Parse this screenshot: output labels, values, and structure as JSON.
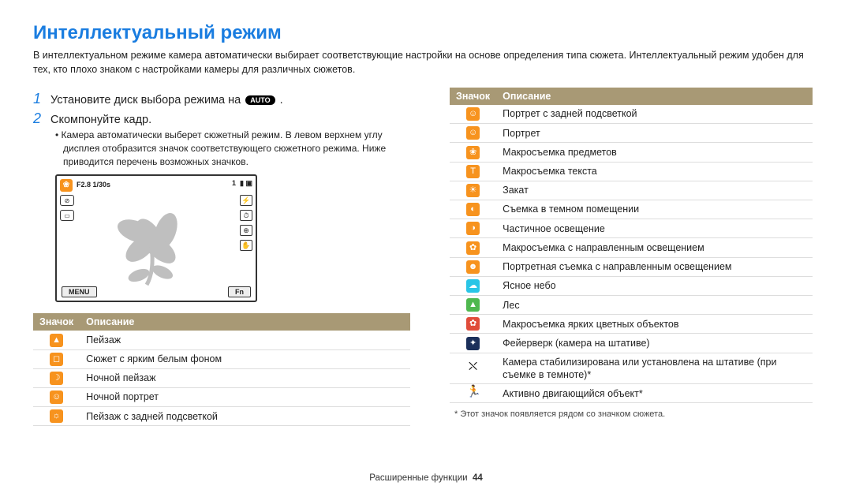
{
  "title": "Интеллектуальный режим",
  "intro": "В интеллектуальном режиме камера автоматически выбирает соответствующие настройки на основе определения типа сюжета. Интеллектуальный режим удобен для тех, кто плохо знаком с настройками камеры для различных сюжетов.",
  "step1_num": "1",
  "step1_text_a": "Установите диск выбора режима на ",
  "step1_text_b": " .",
  "auto_label": "AUTO",
  "step2_num": "2",
  "step2_text": "Скомпонуйте кадр.",
  "bullet": "Камера автоматически выберет сюжетный режим. В левом верхнем углу дисплея отобразится значок соответствующего сюжетного режима. Ниже приводится перечень возможных значков.",
  "lcd": {
    "exposure": "F2.8  1/30s",
    "shots": "1",
    "menu": "MENU",
    "fn": "Fn"
  },
  "th_icon": "Значок",
  "th_desc": "Описание",
  "left_rows": [
    {
      "cls": "orange",
      "glyph": "▲",
      "desc": "Пейзаж"
    },
    {
      "cls": "orange",
      "glyph": "◻",
      "desc": "Сюжет с ярким белым фоном"
    },
    {
      "cls": "orange",
      "glyph": "☽",
      "desc": "Ночной пейзаж"
    },
    {
      "cls": "orange",
      "glyph": "☺",
      "desc": "Ночной портрет"
    },
    {
      "cls": "orange",
      "glyph": "☼",
      "desc": "Пейзаж с задней подсветкой"
    }
  ],
  "right_rows": [
    {
      "cls": "orange",
      "glyph": "☺",
      "desc": "Портрет с задней подсветкой"
    },
    {
      "cls": "orange",
      "glyph": "☺",
      "desc": "Портрет"
    },
    {
      "cls": "orange",
      "glyph": "❀",
      "desc": "Макросъемка предметов"
    },
    {
      "cls": "orange",
      "glyph": "T",
      "desc": "Макросъемка текста"
    },
    {
      "cls": "orange",
      "glyph": "☀",
      "desc": "Закат"
    },
    {
      "cls": "orange",
      "glyph": "◐",
      "desc": "Съемка в темном помещении"
    },
    {
      "cls": "orange",
      "glyph": "◑",
      "desc": "Частичное освещение"
    },
    {
      "cls": "orange",
      "glyph": "✿",
      "desc": "Макросъемка с направленным освещением"
    },
    {
      "cls": "orange",
      "glyph": "☻",
      "desc": "Портретная съемка с направленным освещением"
    },
    {
      "cls": "cyan",
      "glyph": "☁",
      "desc": "Ясное небо"
    },
    {
      "cls": "green",
      "glyph": "▲",
      "desc": "Лес"
    },
    {
      "cls": "red",
      "glyph": "✿",
      "desc": "Макросъемка ярких цветных объектов"
    },
    {
      "cls": "navy",
      "glyph": "✦",
      "desc": "Фейерверк (камера на штативе)"
    },
    {
      "cls": "tripod",
      "glyph": "⛌",
      "desc": "Камера стабилизирована или установлена на штативе (при съемке в темноте)*"
    },
    {
      "cls": "runner",
      "glyph": "🏃",
      "desc": "Активно двигающийся объект*"
    }
  ],
  "footnote": "*  Этот значок появляется рядом со значком сюжета.",
  "footer_label": "Расширенные функции",
  "footer_page": "44"
}
